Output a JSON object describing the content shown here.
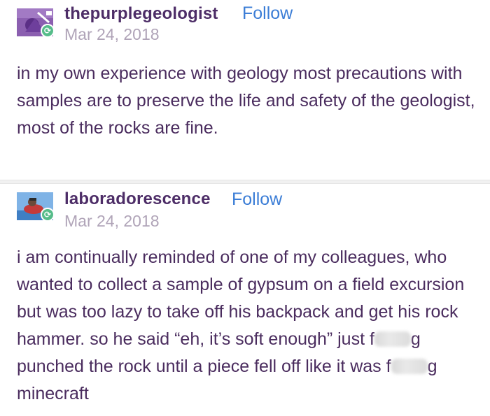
{
  "posts": [
    {
      "username": "thepurplegeologist",
      "follow_label": "Follow",
      "date": "Mar 24, 2018",
      "avatar_icon": "purple-geologist-avatar-icon",
      "badge_icon": "reblog-icon",
      "body": "in my own experience with geology most precautions with samples are to preserve the life and safety of the geologist, most of the rocks are fine."
    },
    {
      "username": "laboradorescence",
      "follow_label": "Follow",
      "date": "Mar 24, 2018",
      "avatar_icon": "laboradorescence-avatar-icon",
      "badge_icon": "reblog-icon",
      "body_parts": [
        "i am continually reminded of one of my colleagues, who wanted to collect a sample of gypsum on a field excursion but was too lazy to take off his backpack and get his rock hammer. so he said “eh, it’s soft enough” just f",
        "g punched the rock until a piece fell off like it was f",
        "g minecraft"
      ]
    }
  ],
  "colors": {
    "username": "#4d2d67",
    "follow": "#3b7dd6",
    "date": "#b0a4b8",
    "body": "#4a2c5e",
    "reblog_badge": "#56bc8a"
  }
}
